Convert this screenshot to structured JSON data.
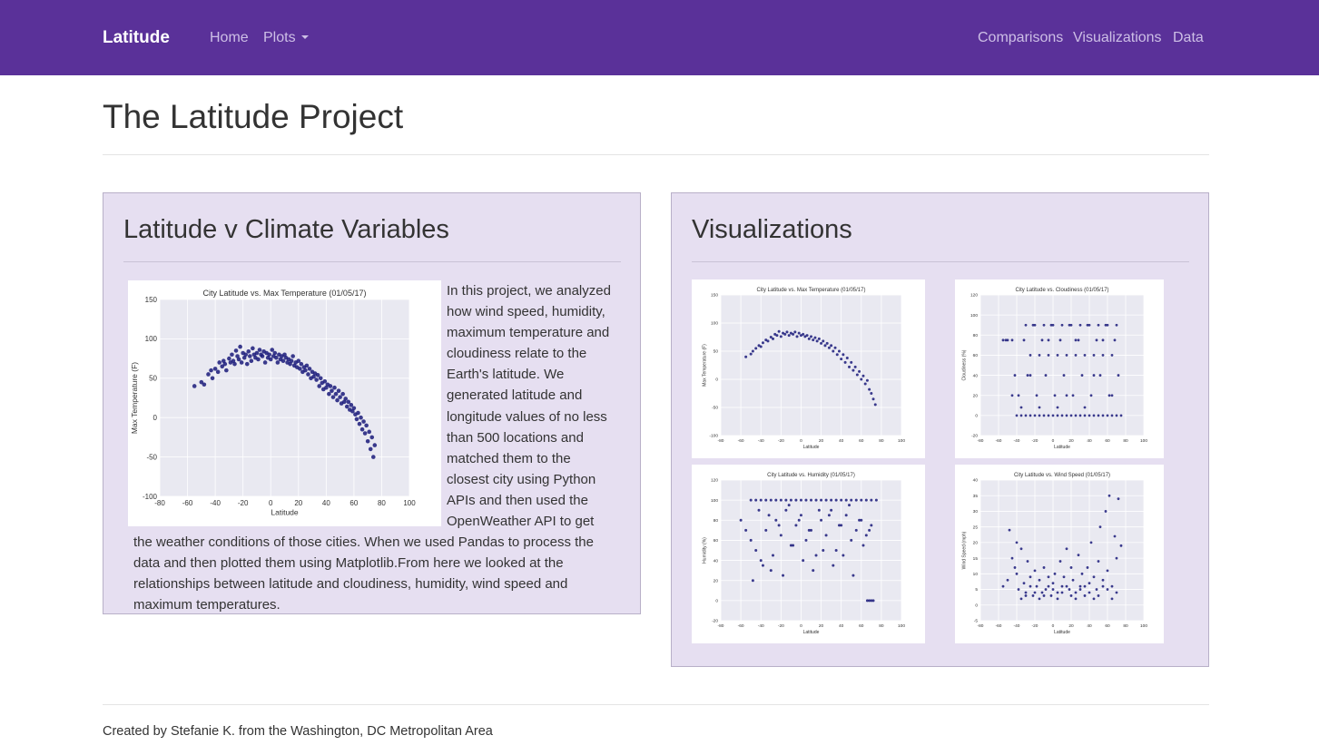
{
  "navbar": {
    "brand": "Latitude",
    "home": "Home",
    "plots": "Plots",
    "comparisons": "Comparisons",
    "visualizations": "Visualizations",
    "data": "Data",
    "bg_color": "#5a3199"
  },
  "page": {
    "title": "The Latitude Project"
  },
  "left_panel": {
    "title": "Latitude v Climate Variables",
    "text": "In this project, we analyzed how wind speed, humidity, maximum temperature and cloudiness relate to the Earth's latitude. We generated latitude and longitude values of no less than 500 locations and matched them to the closest city using Python APIs and then used the OpenWeather API to get the weather conditions of those cities. When we used Pandas to process the data and then plotted them using Matplotlib.From here we looked at the relationships between latitude and cloudiness, humidity, wind speed and maximum temperatures."
  },
  "right_panel": {
    "title": "Visualizations"
  },
  "footer": {
    "text": "Created by Stefanie K. from the Washington, DC Metropolitan Area"
  },
  "chart_data": [
    {
      "type": "scatter",
      "title": "City Latitude vs. Max Temperature (01/05/17)",
      "xlabel": "Latitude",
      "ylabel": "Max Temperature (F)",
      "xlim": [
        -80,
        100
      ],
      "ylim": [
        -100,
        150
      ],
      "xticks": [
        -80,
        -60,
        -40,
        -20,
        0,
        20,
        40,
        60,
        80,
        100
      ],
      "yticks": [
        -100,
        -50,
        0,
        50,
        100,
        150
      ],
      "grid": true,
      "point_color": "#1a1a7a",
      "x": [
        -55,
        -50,
        -48,
        -45,
        -43,
        -42,
        -40,
        -38,
        -37,
        -35,
        -34,
        -33,
        -32,
        -30,
        -29,
        -28,
        -27,
        -26,
        -25,
        -24,
        -23,
        -22,
        -21,
        -20,
        -19,
        -18,
        -17,
        -16,
        -15,
        -14,
        -13,
        -12,
        -11,
        -10,
        -9,
        -8,
        -7,
        -6,
        -5,
        -4,
        -3,
        -2,
        -1,
        0,
        1,
        2,
        3,
        4,
        5,
        6,
        7,
        8,
        9,
        10,
        11,
        12,
        13,
        14,
        15,
        16,
        17,
        18,
        19,
        20,
        21,
        22,
        23,
        24,
        25,
        26,
        27,
        28,
        29,
        30,
        31,
        32,
        33,
        34,
        35,
        36,
        37,
        38,
        39,
        40,
        41,
        42,
        43,
        44,
        45,
        46,
        47,
        48,
        49,
        50,
        51,
        52,
        53,
        54,
        55,
        56,
        57,
        58,
        59,
        60,
        61,
        62,
        63,
        64,
        65,
        66,
        67,
        68,
        69,
        70,
        71,
        72,
        73,
        74,
        75
      ],
      "y": [
        40,
        45,
        42,
        55,
        60,
        50,
        62,
        58,
        70,
        65,
        72,
        68,
        60,
        75,
        70,
        80,
        72,
        68,
        85,
        78,
        74,
        90,
        70,
        82,
        76,
        80,
        68,
        84,
        78,
        72,
        88,
        80,
        76,
        82,
        74,
        86,
        80,
        78,
        84,
        70,
        82,
        76,
        80,
        74,
        86,
        78,
        82,
        76,
        70,
        80,
        74,
        78,
        72,
        80,
        76,
        70,
        74,
        68,
        72,
        78,
        66,
        70,
        64,
        72,
        62,
        68,
        58,
        64,
        60,
        66,
        55,
        62,
        50,
        58,
        52,
        56,
        48,
        54,
        40,
        50,
        44,
        36,
        46,
        38,
        42,
        30,
        40,
        34,
        26,
        38,
        30,
        22,
        34,
        26,
        18,
        30,
        20,
        24,
        14,
        20,
        10,
        16,
        8,
        12,
        4,
        -2,
        6,
        -8,
        0,
        -15,
        -5,
        -20,
        -10,
        -30,
        -18,
        -40,
        -25,
        -50,
        -35,
        -45
      ]
    },
    {
      "type": "scatter",
      "title": "City Latitude vs. Max Temperature (01/05/17)",
      "xlabel": "Latitude",
      "ylabel": "Max Temperature (F)",
      "xlim": [
        -80,
        100
      ],
      "ylim": [
        -100,
        150
      ],
      "xticks": [
        -80,
        -60,
        -40,
        -20,
        0,
        20,
        40,
        60,
        80,
        100
      ],
      "yticks": [
        -100,
        -50,
        0,
        50,
        100,
        150
      ],
      "grid": true,
      "point_color": "#1a1a7a",
      "x": [
        -55,
        -50,
        -48,
        -45,
        -42,
        -40,
        -38,
        -35,
        -33,
        -30,
        -28,
        -26,
        -24,
        -22,
        -20,
        -18,
        -16,
        -14,
        -12,
        -10,
        -8,
        -6,
        -4,
        -2,
        0,
        2,
        4,
        6,
        8,
        10,
        12,
        14,
        16,
        18,
        20,
        22,
        24,
        26,
        28,
        30,
        32,
        34,
        36,
        38,
        40,
        42,
        44,
        46,
        48,
        50,
        52,
        54,
        56,
        58,
        60,
        62,
        64,
        66,
        68,
        70,
        72,
        74
      ],
      "y": [
        40,
        45,
        50,
        55,
        60,
        58,
        65,
        70,
        68,
        75,
        72,
        80,
        78,
        85,
        76,
        82,
        80,
        84,
        78,
        82,
        80,
        84,
        76,
        82,
        78,
        80,
        76,
        78,
        72,
        76,
        70,
        74,
        68,
        72,
        64,
        68,
        60,
        64,
        56,
        60,
        50,
        56,
        44,
        50,
        36,
        44,
        30,
        38,
        22,
        30,
        16,
        22,
        8,
        14,
        0,
        6,
        -8,
        -2,
        -18,
        -25,
        -35,
        -45
      ]
    },
    {
      "type": "scatter",
      "title": "City Latitude vs. Cloudiness (01/05/17)",
      "xlabel": "Latitude",
      "ylabel": "Cloudiness (%)",
      "xlim": [
        -80,
        100
      ],
      "ylim": [
        -20,
        120
      ],
      "xticks": [
        -80,
        -60,
        -40,
        -20,
        0,
        20,
        40,
        60,
        80,
        100
      ],
      "yticks": [
        -20,
        0,
        20,
        40,
        60,
        80,
        100,
        120
      ],
      "grid": true,
      "point_color": "#1a1a7a",
      "x": [
        -55,
        -50,
        -45,
        -40,
        -35,
        -30,
        -25,
        -20,
        -15,
        -10,
        -5,
        0,
        5,
        10,
        15,
        20,
        25,
        30,
        35,
        40,
        45,
        50,
        55,
        60,
        65,
        70,
        -52,
        -42,
        -32,
        -22,
        -12,
        -2,
        8,
        18,
        28,
        38,
        48,
        58,
        68,
        -38,
        -28,
        -18,
        -8,
        2,
        12,
        22,
        32,
        42,
        52,
        62,
        72,
        -30,
        -20,
        -10,
        0,
        10,
        20,
        30,
        40,
        50,
        60,
        70,
        -25,
        -15,
        -5,
        5,
        15,
        25,
        35,
        45,
        55,
        65,
        -45,
        -35,
        -25,
        -15,
        -5,
        5,
        15,
        25,
        35,
        45,
        55,
        65,
        75
      ],
      "y": [
        75,
        75,
        75,
        0,
        0,
        0,
        0,
        0,
        0,
        0,
        0,
        0,
        0,
        0,
        0,
        0,
        0,
        0,
        0,
        0,
        0,
        0,
        0,
        0,
        0,
        0,
        75,
        40,
        75,
        90,
        75,
        90,
        75,
        90,
        75,
        90,
        75,
        90,
        75,
        20,
        40,
        20,
        40,
        20,
        40,
        20,
        40,
        20,
        40,
        20,
        40,
        90,
        90,
        90,
        90,
        90,
        90,
        90,
        90,
        90,
        90,
        90,
        60,
        60,
        60,
        60,
        60,
        60,
        60,
        60,
        60,
        60,
        20,
        8,
        40,
        8,
        75,
        8,
        20,
        75,
        8,
        40,
        75,
        20,
        0
      ]
    },
    {
      "type": "scatter",
      "title": "City Latitude vs. Humidity (01/05/17)",
      "xlabel": "Latitude",
      "ylabel": "Humidity (%)",
      "xlim": [
        -80,
        100
      ],
      "ylim": [
        -20,
        120
      ],
      "xticks": [
        -80,
        -60,
        -40,
        -20,
        0,
        20,
        40,
        60,
        80,
        100
      ],
      "yticks": [
        -20,
        0,
        20,
        40,
        60,
        80,
        100,
        120
      ],
      "grid": true,
      "point_color": "#1a1a7a",
      "x": [
        -60,
        -55,
        -50,
        -45,
        -40,
        -35,
        -30,
        -25,
        -20,
        -15,
        -10,
        -5,
        0,
        5,
        10,
        15,
        20,
        25,
        30,
        35,
        40,
        45,
        50,
        55,
        60,
        65,
        70,
        75,
        -50,
        -45,
        -40,
        -35,
        -30,
        -25,
        -20,
        -15,
        -10,
        -5,
        0,
        5,
        10,
        15,
        20,
        25,
        30,
        35,
        40,
        45,
        50,
        55,
        60,
        65,
        70,
        -48,
        -38,
        -28,
        -18,
        -8,
        2,
        12,
        22,
        32,
        42,
        52,
        62,
        -42,
        -32,
        -22,
        -12,
        -2,
        8,
        18,
        28,
        38,
        48,
        58,
        68,
        66,
        68,
        70,
        72
      ],
      "y": [
        80,
        70,
        100,
        100,
        100,
        100,
        100,
        100,
        100,
        100,
        100,
        100,
        100,
        100,
        100,
        100,
        100,
        100,
        100,
        100,
        100,
        100,
        100,
        100,
        100,
        100,
        100,
        100,
        60,
        50,
        40,
        70,
        30,
        80,
        65,
        90,
        55,
        75,
        85,
        60,
        70,
        45,
        80,
        65,
        90,
        50,
        75,
        85,
        60,
        70,
        80,
        65,
        75,
        20,
        35,
        45,
        25,
        55,
        40,
        30,
        50,
        35,
        45,
        25,
        55,
        90,
        85,
        75,
        95,
        80,
        70,
        90,
        85,
        75,
        95,
        80,
        70,
        0,
        0,
        0,
        0
      ]
    },
    {
      "type": "scatter",
      "title": "City Latitude vs. Wind Speed (01/05/17)",
      "xlabel": "Latitude",
      "ylabel": "Wind Speed (mph)",
      "xlim": [
        -80,
        100
      ],
      "ylim": [
        -5,
        40
      ],
      "xticks": [
        -80,
        -60,
        -40,
        -20,
        0,
        20,
        40,
        60,
        80,
        100
      ],
      "yticks": [
        -5,
        0,
        5,
        10,
        15,
        20,
        25,
        30,
        35,
        40
      ],
      "grid": true,
      "point_color": "#1a1a7a",
      "x": [
        -55,
        -50,
        -48,
        -45,
        -42,
        -40,
        -38,
        -35,
        -32,
        -30,
        -28,
        -25,
        -22,
        -20,
        -18,
        -15,
        -12,
        -10,
        -8,
        -5,
        -2,
        0,
        2,
        5,
        8,
        10,
        12,
        15,
        18,
        20,
        22,
        25,
        28,
        30,
        32,
        35,
        38,
        40,
        42,
        45,
        48,
        50,
        52,
        55,
        58,
        60,
        62,
        65,
        68,
        70,
        72,
        75,
        -40,
        -30,
        -20,
        -10,
        0,
        10,
        20,
        30,
        40,
        50,
        60,
        70,
        -35,
        -25,
        -15,
        -5,
        5,
        15,
        25,
        35,
        45,
        55,
        65
      ],
      "y": [
        6,
        8,
        24,
        15,
        12,
        10,
        5,
        18,
        7,
        4,
        14,
        9,
        3,
        11,
        6,
        8,
        4,
        12,
        5,
        9,
        3,
        7,
        10,
        4,
        14,
        6,
        9,
        18,
        5,
        12,
        8,
        4,
        16,
        6,
        10,
        3,
        12,
        7,
        20,
        9,
        5,
        14,
        25,
        8,
        30,
        11,
        35,
        6,
        22,
        15,
        34,
        19,
        20,
        3,
        4,
        3,
        5,
        4,
        3,
        5,
        4,
        3,
        5,
        4,
        2,
        6,
        2,
        6,
        2,
        6,
        2,
        6,
        2,
        6,
        2
      ]
    }
  ]
}
